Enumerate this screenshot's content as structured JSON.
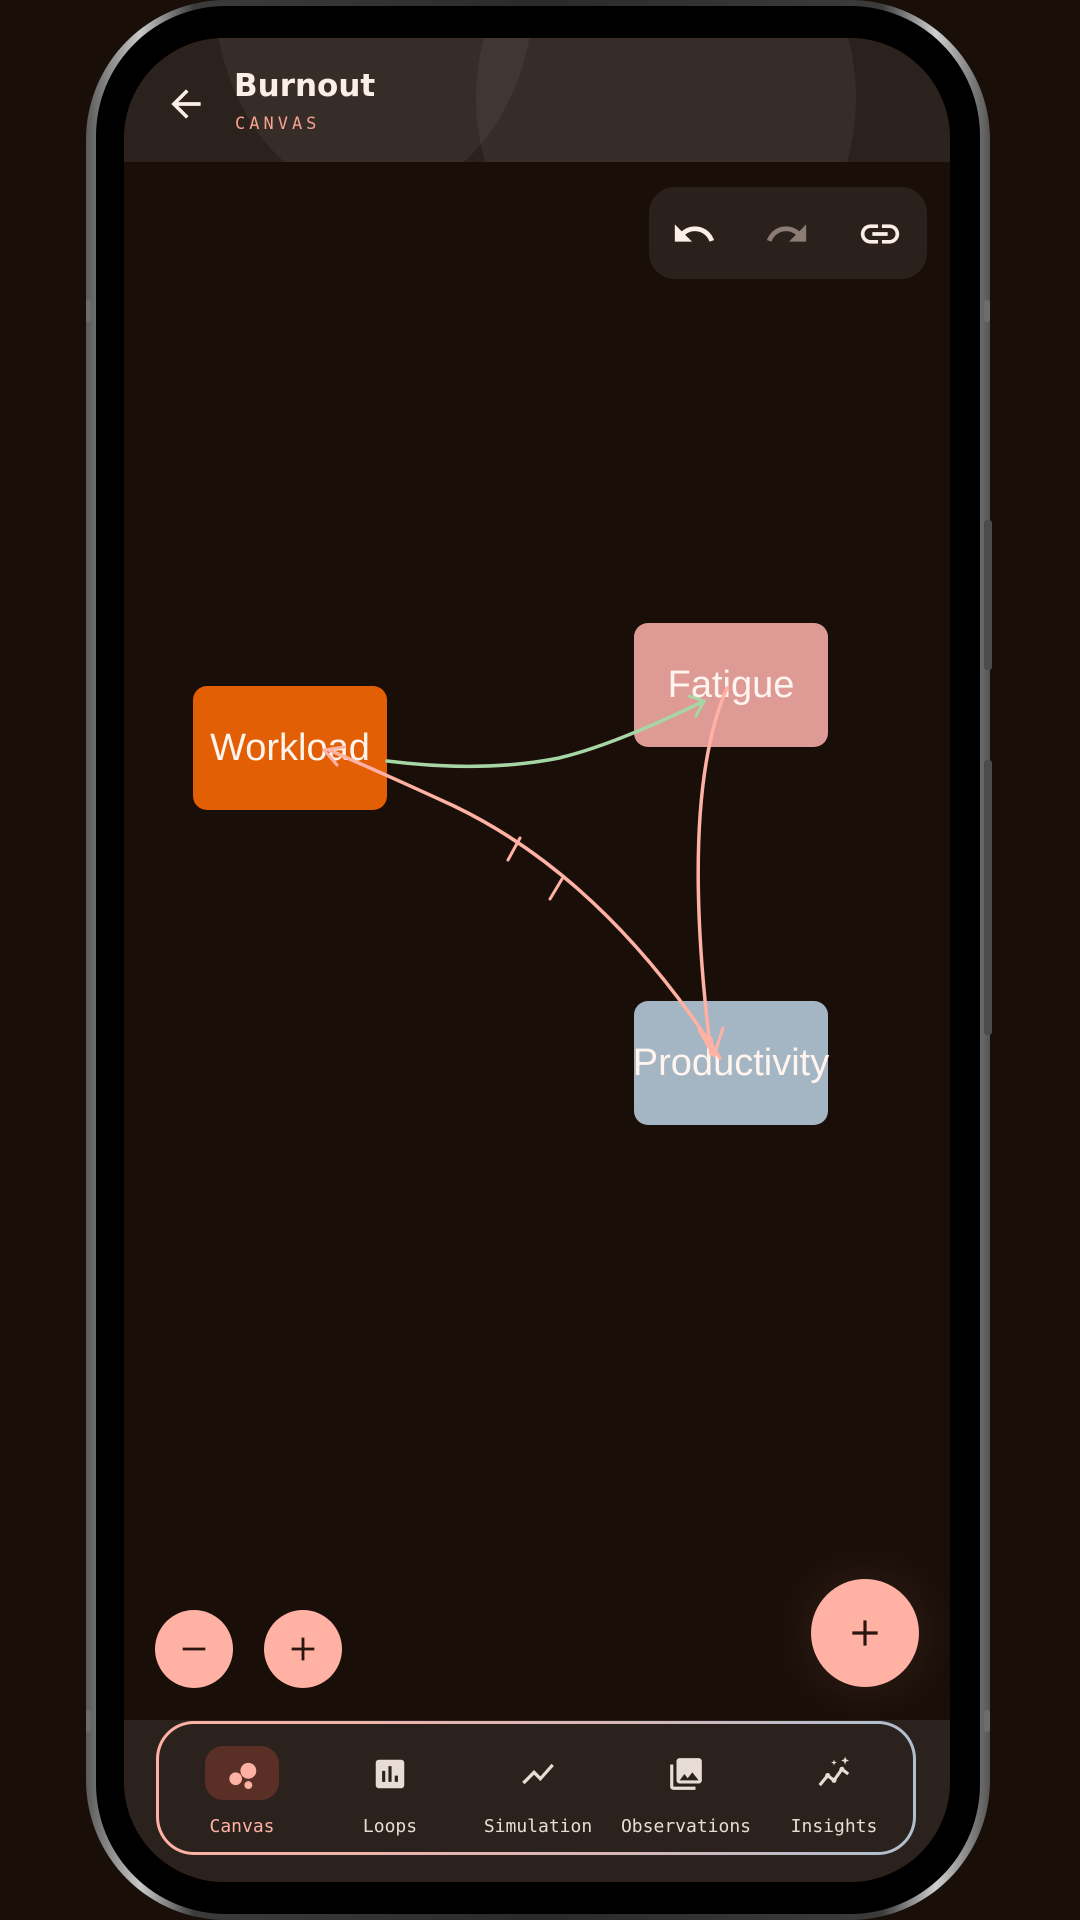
{
  "header": {
    "title": "Burnout",
    "subtitle": "CANVAS",
    "back_icon": "arrow-left-icon"
  },
  "toolbar": {
    "buttons": [
      {
        "name": "undo",
        "icon": "undo-icon",
        "enabled": true
      },
      {
        "name": "redo",
        "icon": "redo-icon",
        "enabled": false
      },
      {
        "name": "link",
        "icon": "link-icon",
        "enabled": true
      }
    ]
  },
  "nodes": [
    {
      "id": "workload",
      "label": "Workload",
      "color": "#e25f05"
    },
    {
      "id": "fatigue",
      "label": "Fatigue",
      "color": "#de9a95"
    },
    {
      "id": "productivity",
      "label": "Productivity",
      "color": "#a4b5c3"
    }
  ],
  "edges": [
    {
      "from": "Workload",
      "to": "Fatigue",
      "color": "#a6d6a3",
      "delayed": false
    },
    {
      "from": "Fatigue",
      "to": "Productivity",
      "color": "#ffb1a3",
      "delayed": false
    },
    {
      "from": "Productivity",
      "to": "Workload",
      "color": "#ffb1a3",
      "delayed": true
    }
  ],
  "controls": {
    "zoom_out_icon": "minus-icon",
    "zoom_in_icon": "plus-icon",
    "add_icon": "plus-icon"
  },
  "nav": {
    "items": [
      {
        "label": "Canvas",
        "icon": "bubbles-icon",
        "active": true
      },
      {
        "label": "Loops",
        "icon": "bar-chart-icon",
        "active": false
      },
      {
        "label": "Simulation",
        "icon": "trend-line-icon",
        "active": false
      },
      {
        "label": "Observations",
        "icon": "photo-library-icon",
        "active": false
      },
      {
        "label": "Insights",
        "icon": "sparkle-chart-icon",
        "active": false
      }
    ]
  },
  "colors": {
    "background": "#190e08",
    "accent": "#ffb1a3",
    "surface": "#2c221d"
  }
}
